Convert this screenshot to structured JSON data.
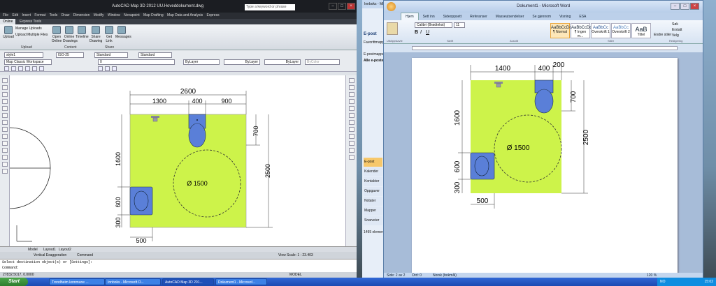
{
  "acad": {
    "title": "AutoCAD Map 3D 2012   UU.Hoveddokument.dwg",
    "search_placeholder": "Type a keyword or phrase",
    "menu": [
      "File",
      "Edit",
      "Insert",
      "Format",
      "Tools",
      "Draw",
      "Dimension",
      "Modify",
      "Window",
      "Novapoint",
      "Map Drafting",
      "Map Data and Analysis",
      "Express"
    ],
    "tabs": [
      "Online",
      "Express Tools"
    ],
    "ribbon": {
      "upload": "Upload",
      "manage_uploads": "Manage Uploads",
      "upload_multiple": "Upload Multiple Files",
      "open_online": "Open Online",
      "online_drawings": "Online Drawings",
      "timeline": "Timeline",
      "share_drawing": "Share Drawing",
      "get_link": "Get Link",
      "messages": "Messages",
      "groups": [
        "Upload",
        "Content",
        "Share"
      ]
    },
    "props": {
      "style": "style1",
      "dimstyle": "ISO-25",
      "textstyle": "Standard",
      "tablestyle": "Standard",
      "workspace": "Map Classic Workspace",
      "layer": "0",
      "color": "ByLayer",
      "linetype": "ByLayer",
      "lineweight": "ByLayer",
      "plotstyle": "ByColor"
    },
    "drawing": {
      "total_width": "2600",
      "segments_top": [
        "1300",
        "400",
        "900"
      ],
      "left_dim": "1600",
      "left_dim_lower": "600",
      "left_dim_bottom": "300",
      "right_dim_top": "700",
      "right_dim": "2500",
      "bottom_dim": "500",
      "circle": "Ø 1500"
    },
    "layout_tabs": [
      "Model",
      "Layout1",
      "Layout2"
    ],
    "status": {
      "vertical": "Vertical Exaggeration",
      "command": "Command",
      "view_scale": "View Scale: 1 : 23.403"
    },
    "cmd_lines": [
      "Select destination object(s) or [Settings]:",
      "Command:"
    ],
    "coords": "27832.5017, 0.0000",
    "model": "MODEL"
  },
  "outlook": {
    "title": "Innboks - Microsoft Outlook",
    "nav": [
      "E-post",
      "Kalender",
      "Kontakter",
      "Oppgaver",
      "Notater",
      "Mapper",
      "Snarveier"
    ],
    "folders": [
      "Favorittmapper",
      "E-postmapper",
      "Alle e-postelementer"
    ],
    "count": "1495 elementer"
  },
  "word": {
    "title": "Dokument1 - Microsoft Word",
    "tabs": [
      "Hjem",
      "Sett inn",
      "Sideoppsett",
      "Referanser",
      "Masseutsendelser",
      "Se gjennom",
      "Visning",
      "ESA"
    ],
    "font": "Calibri (Brødtekst)",
    "size": "11",
    "styles": [
      {
        "sample": "AaBbCcDc",
        "name": "¶ Normal"
      },
      {
        "sample": "AaBbCcDc",
        "name": "¶ Ingen m..."
      },
      {
        "sample": "AaBbCc",
        "name": "Overskrift 1"
      },
      {
        "sample": "AaBbCc",
        "name": "Overskrift 2"
      },
      {
        "sample": "AaB",
        "name": "Tittel"
      }
    ],
    "change_styles": "Endre stiler",
    "edit": [
      "Søk",
      "Erstatt",
      "Velg"
    ],
    "groups": [
      "Utklippstavle",
      "Skrift",
      "Avsnitt",
      "Stiler",
      "Redigering"
    ],
    "drawing": {
      "top_segments": [
        "1400",
        "400",
        "200"
      ],
      "left_dim": "1600",
      "left_dim_lower": "600",
      "left_dim_bottom": "300",
      "right_dim_top": "700",
      "right_dim": "2500",
      "bottom_dim": "500",
      "circle": "Ø 1500"
    },
    "status": {
      "page": "Side: 2 av 2",
      "words": "Ord: 0",
      "lang": "Norsk (bokmål)",
      "zoom": "120 %"
    }
  },
  "taskbar": {
    "start": "Start",
    "tasks": [
      "Trondheim kommune ...",
      "Innboks - Microsoft O...",
      "AutoCAD Map 3D 201...",
      "Dokument1 - Microsof..."
    ],
    "lang": "NO",
    "time": "15:02"
  }
}
